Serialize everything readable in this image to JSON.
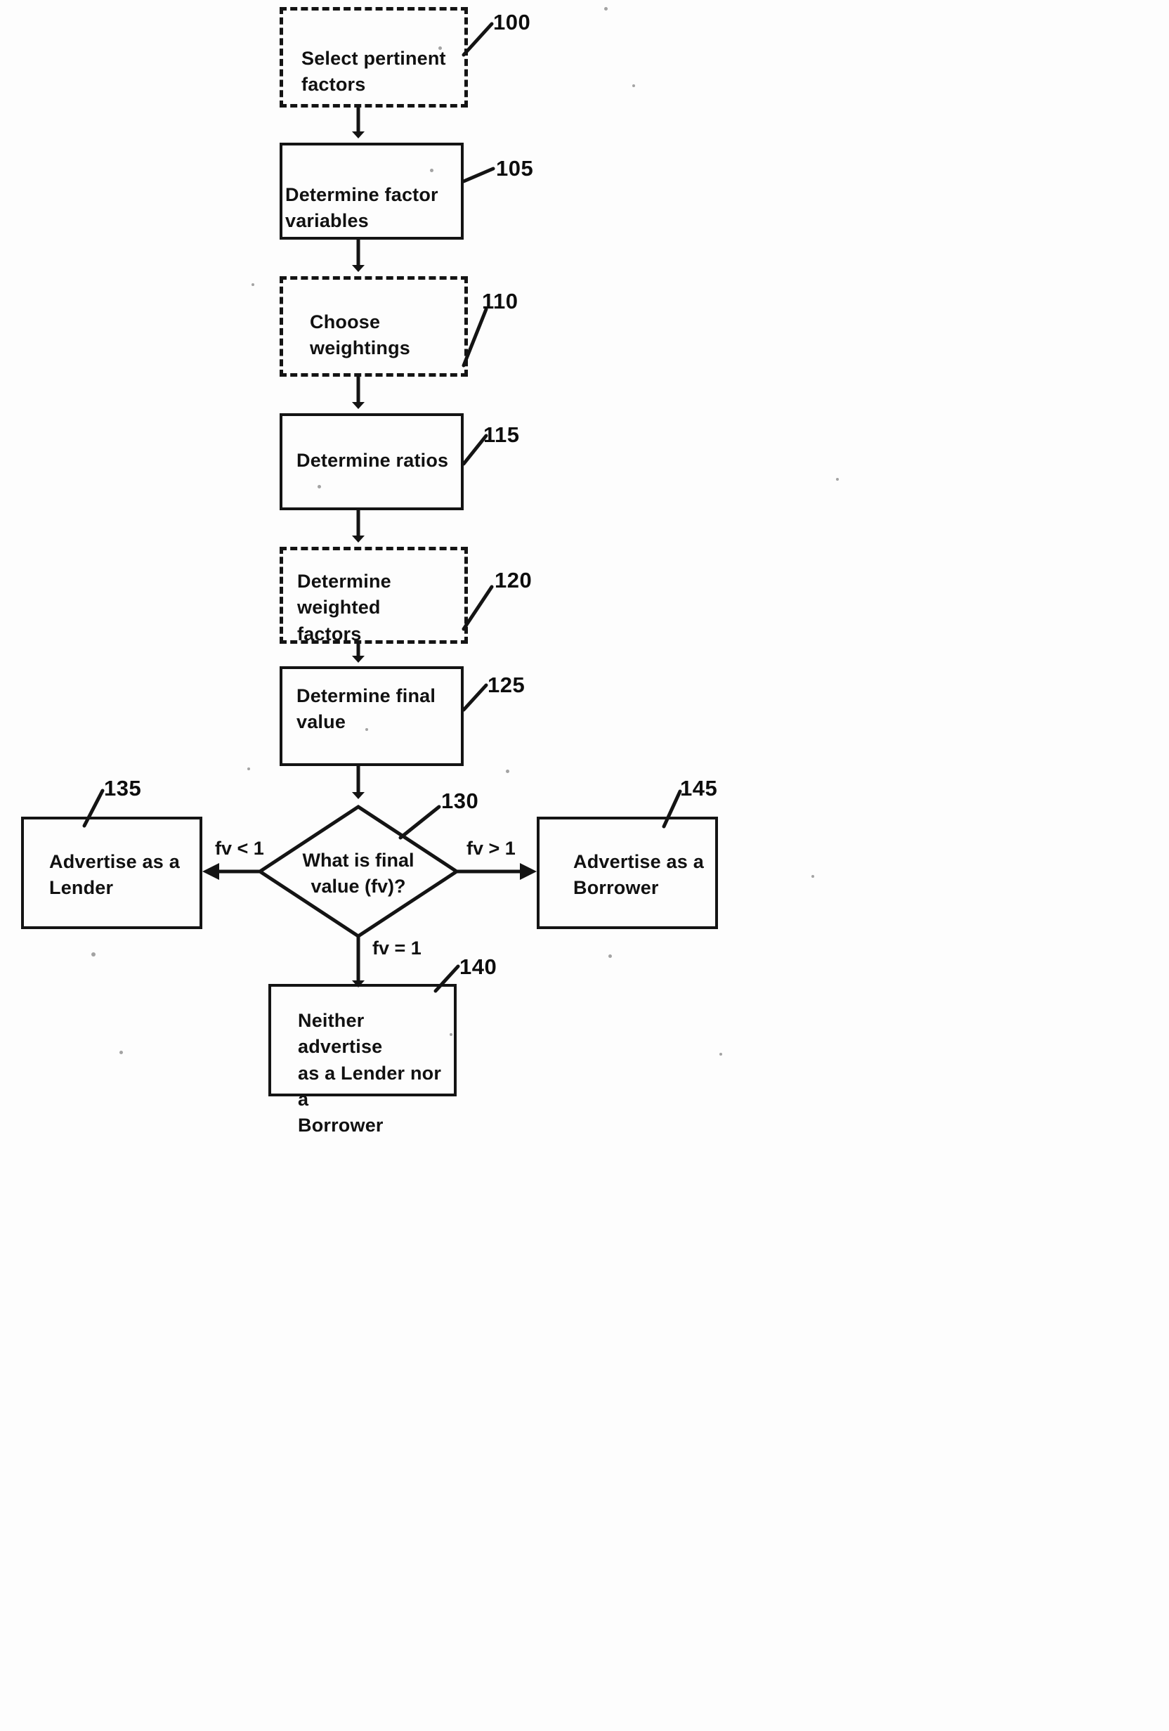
{
  "figure": {
    "type": "patent-flowchart",
    "background_color": "#fdfdfd",
    "line_color": "#141414"
  },
  "nodes": [
    {
      "id": "100",
      "ref": "100",
      "label": "Select pertinent\nfactors",
      "style": "dashed"
    },
    {
      "id": "105",
      "ref": "105",
      "label": "Determine factor variables",
      "style": "solid"
    },
    {
      "id": "110",
      "ref": "110",
      "label": "Choose weightings",
      "style": "dashed"
    },
    {
      "id": "115",
      "ref": "115",
      "label": "Determine ratios",
      "style": "solid"
    },
    {
      "id": "120",
      "ref": "120",
      "label": "Determine weighted\nfactors",
      "style": "dashed"
    },
    {
      "id": "125",
      "ref": "125",
      "label": "Determine final value",
      "style": "solid"
    },
    {
      "id": "130",
      "ref": "130",
      "label": "What is final\nvalue (fv)?",
      "style": "diamond"
    },
    {
      "id": "135",
      "ref": "135",
      "label": "Advertise as a\nLender",
      "style": "solid"
    },
    {
      "id": "145",
      "ref": "145",
      "label": "Advertise as a\nBorrower",
      "style": "solid"
    },
    {
      "id": "140",
      "ref": "140",
      "label": "Neither advertise\nas a Lender nor a\nBorrower",
      "style": "solid"
    }
  ],
  "branch_labels": {
    "left": "fv < 1",
    "right": "fv > 1",
    "down": "fv = 1"
  },
  "chart_data": {
    "type": "table",
    "title": "",
    "flow_sequence": [
      "100 Select pertinent factors",
      "105 Determine factor variables",
      "110 Choose weightings",
      "115 Determine ratios",
      "120 Determine weighted factors",
      "125 Determine final value",
      "130 What is final value (fv)?"
    ],
    "decision_branches": [
      {
        "condition": "fv < 1",
        "target_ref": "135",
        "target": "Advertise as a Lender"
      },
      {
        "condition": "fv > 1",
        "target_ref": "145",
        "target": "Advertise as a Borrower"
      },
      {
        "condition": "fv = 1",
        "target_ref": "140",
        "target": "Neither advertise as a Lender nor a Borrower"
      }
    ]
  }
}
